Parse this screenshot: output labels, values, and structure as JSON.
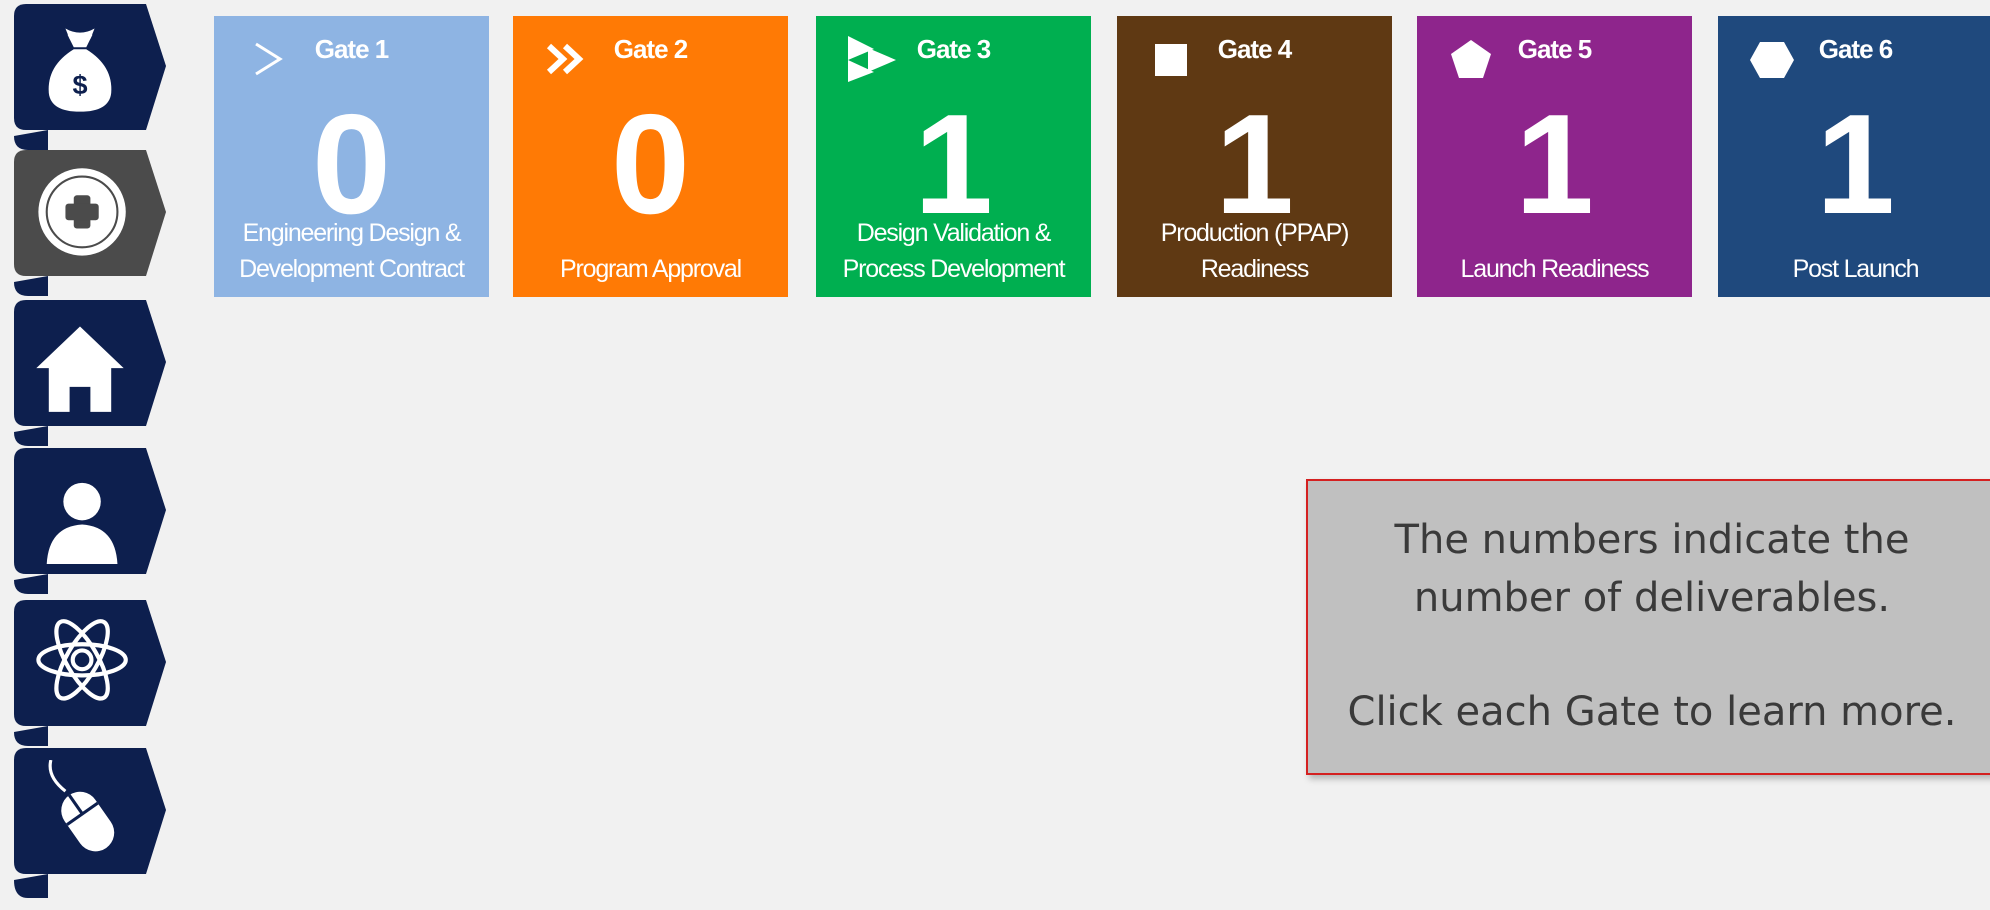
{
  "sidebar": {
    "items": [
      {
        "icon": "money-bag-icon"
      },
      {
        "icon": "plus-circle-icon",
        "active": true
      },
      {
        "icon": "home-icon"
      },
      {
        "icon": "user-icon"
      },
      {
        "icon": "atom-icon"
      },
      {
        "icon": "mouse-icon"
      }
    ],
    "colors": {
      "tab": "#0d1f4e",
      "active_tab": "#4b4b4b"
    }
  },
  "gates": [
    {
      "title": "Gate 1",
      "count": "0",
      "subtitle": "Engineering Design &\nDevelopment Contract",
      "color": "#8eb4e3",
      "icon": "chevron-right-icon"
    },
    {
      "title": "Gate 2",
      "count": "0",
      "subtitle": "Program Approval",
      "color": "#ff7a05",
      "icon": "double-chevron-icon"
    },
    {
      "title": "Gate 3",
      "count": "1",
      "subtitle": "Design Validation &\nProcess Development",
      "color": "#00af50",
      "icon": "triangle-flags-icon"
    },
    {
      "title": "Gate 4",
      "count": "1",
      "subtitle": "Production (PPAP)\nReadiness",
      "color": "#5f3913",
      "icon": "square-icon"
    },
    {
      "title": "Gate 5",
      "count": "1",
      "subtitle": "Launch Readiness",
      "color": "#8e258c",
      "icon": "pentagon-icon"
    },
    {
      "title": "Gate 6",
      "count": "1",
      "subtitle": "Post Launch",
      "color": "#1f497d",
      "icon": "hexagon-icon"
    }
  ],
  "info": {
    "line1": "The numbers indicate the",
    "line2": "number of deliverables.",
    "line3": "Click each Gate to learn more."
  }
}
